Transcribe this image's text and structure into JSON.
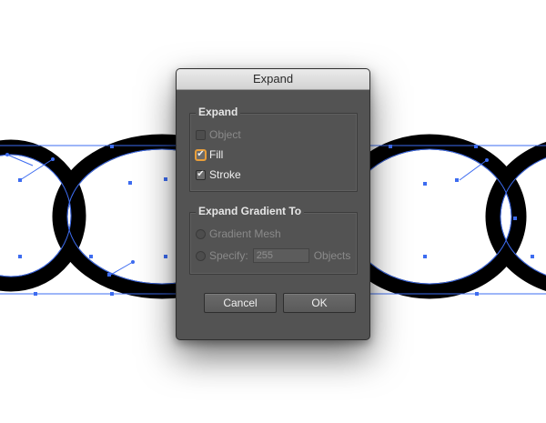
{
  "dialog": {
    "title": "Expand",
    "expand_group": {
      "legend": "Expand",
      "options": [
        {
          "label": "Object",
          "checked": false,
          "enabled": false
        },
        {
          "label": "Fill",
          "checked": true,
          "enabled": true,
          "focused": true
        },
        {
          "label": "Stroke",
          "checked": true,
          "enabled": true
        }
      ]
    },
    "gradient_group": {
      "legend": "Expand Gradient To",
      "gradient_mesh_label": "Gradient Mesh",
      "specify_label": "Specify:",
      "specify_value": "255",
      "objects_label": "Objects",
      "enabled": false
    },
    "buttons": {
      "cancel": "Cancel",
      "ok": "OK"
    }
  },
  "colors": {
    "dialog_bg": "#535353",
    "path_stroke": "#000000",
    "selection_guide": "#3d6cf0",
    "focus_ring": "#e89e3a"
  },
  "check_glyph": "✔"
}
